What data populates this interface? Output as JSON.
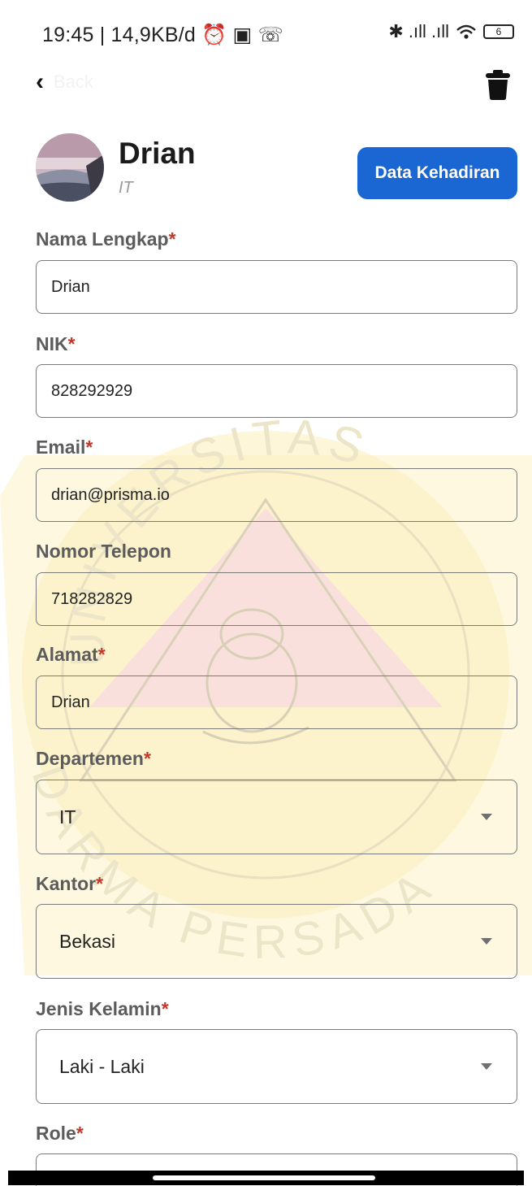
{
  "status_bar": {
    "time_info": "19:45 | 14,9KB/d",
    "notif_icons": "⏰ ▣ ☏",
    "right_icons": "✱ .ıll .ıll",
    "battery": "6"
  },
  "nav": {
    "back_label": "Back"
  },
  "profile": {
    "name": "Drian",
    "department": "IT"
  },
  "actions": {
    "attendance_label": "Data Kehadiran"
  },
  "form": {
    "full_name": {
      "label": "Nama Lengkap",
      "required": "*",
      "value": "Drian"
    },
    "nik": {
      "label": "NIK",
      "required": "*",
      "value": "828292929"
    },
    "email": {
      "label": "Email",
      "required": "*",
      "value": "drian@prisma.io"
    },
    "phone": {
      "label": "Nomor Telepon",
      "value": "718282829"
    },
    "address": {
      "label": "Alamat",
      "required": "*",
      "value": "Drian"
    },
    "department": {
      "label": "Departemen",
      "required": "*",
      "value": "IT"
    },
    "office": {
      "label": "Kantor",
      "required": "*",
      "value": "Bekasi"
    },
    "gender": {
      "label": "Jenis Kelamin",
      "required": "*",
      "value": "Laki - Laki"
    },
    "role": {
      "label": "Role",
      "required": "*"
    }
  },
  "watermark": {
    "top_text": "UNIVERSITAS",
    "bottom_text": "DARMA PERSADA"
  },
  "colors": {
    "accent": "#1a66d2",
    "required": "#c0392b",
    "watermark_yellow": "#fbf3c4",
    "watermark_red": "#f9dede"
  }
}
